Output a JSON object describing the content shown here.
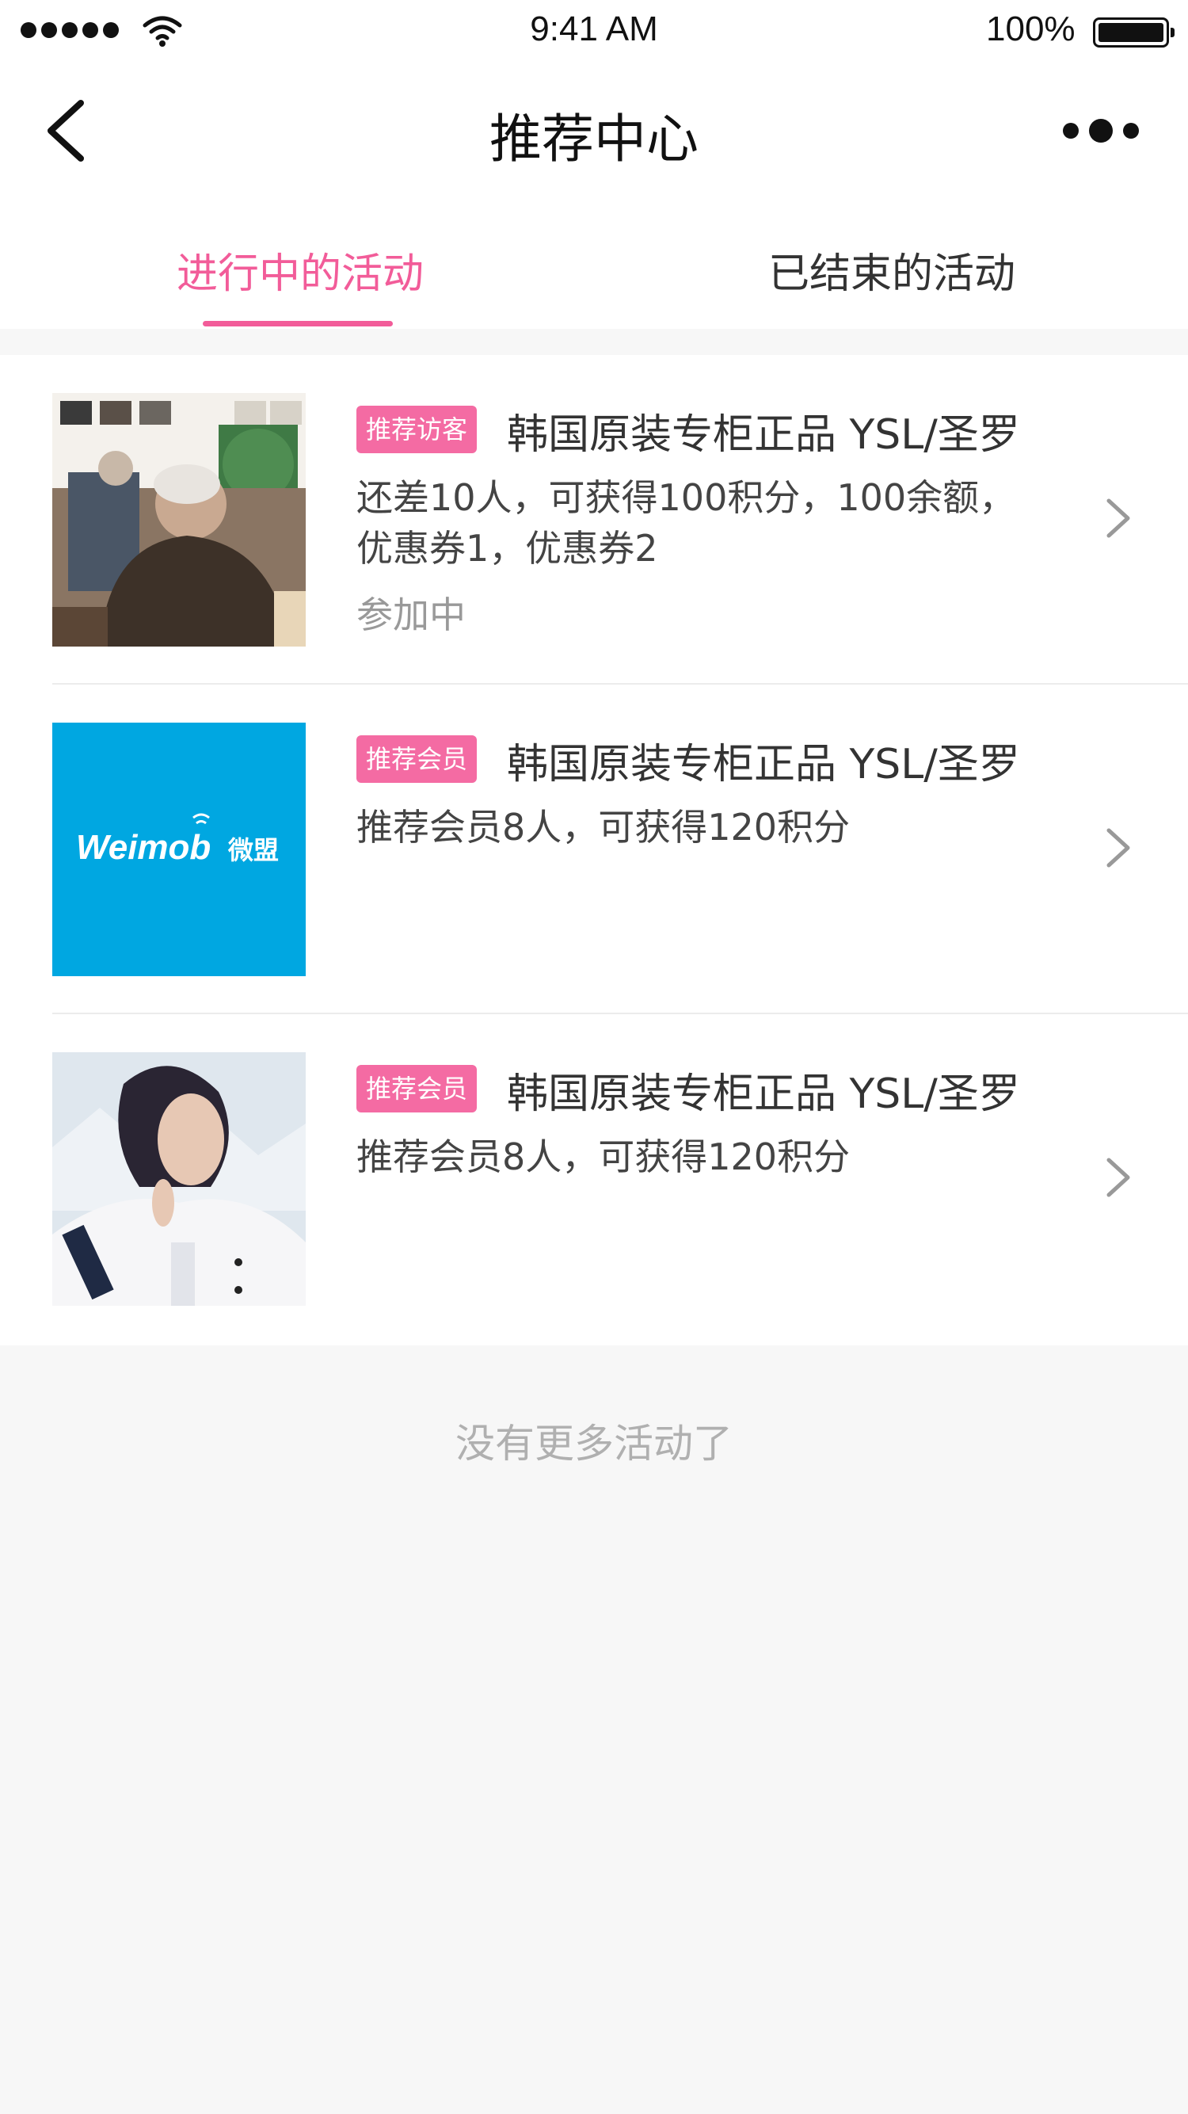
{
  "status_bar": {
    "time": "9:41 AM",
    "battery_percent": "100%"
  },
  "nav": {
    "title": "推荐中心",
    "back_icon": "chevron-left-icon",
    "more_icon": "more-dots-icon"
  },
  "tabs": [
    {
      "label": "进行中的活动",
      "active": true
    },
    {
      "label": "已结束的活动",
      "active": false
    }
  ],
  "colors": {
    "accent": "#f25c99",
    "tag": "#f46ba3",
    "weimob_blue": "#00a7e1"
  },
  "activities": [
    {
      "tag": "推荐访客",
      "title": "韩国原装专柜正品 YSL/圣罗",
      "description": "还差10人，可获得100积分，100余额，优惠券1，优惠券2",
      "status": "参加中",
      "image": "man-in-cafe-photo"
    },
    {
      "tag": "推荐会员",
      "title": "韩国原装专柜正品 YSL/圣罗",
      "description": "推荐会员8人，可获得120积分",
      "status": "",
      "image": "weimob-logo",
      "logo_text": "Weimob",
      "logo_cn": "微盟"
    },
    {
      "tag": "推荐会员",
      "title": "韩国原装专柜正品 YSL/圣罗",
      "description": "推荐会员8人，可获得120积分",
      "status": "",
      "image": "woman-in-white-jacket-photo"
    }
  ],
  "footer_note": "没有更多活动了"
}
